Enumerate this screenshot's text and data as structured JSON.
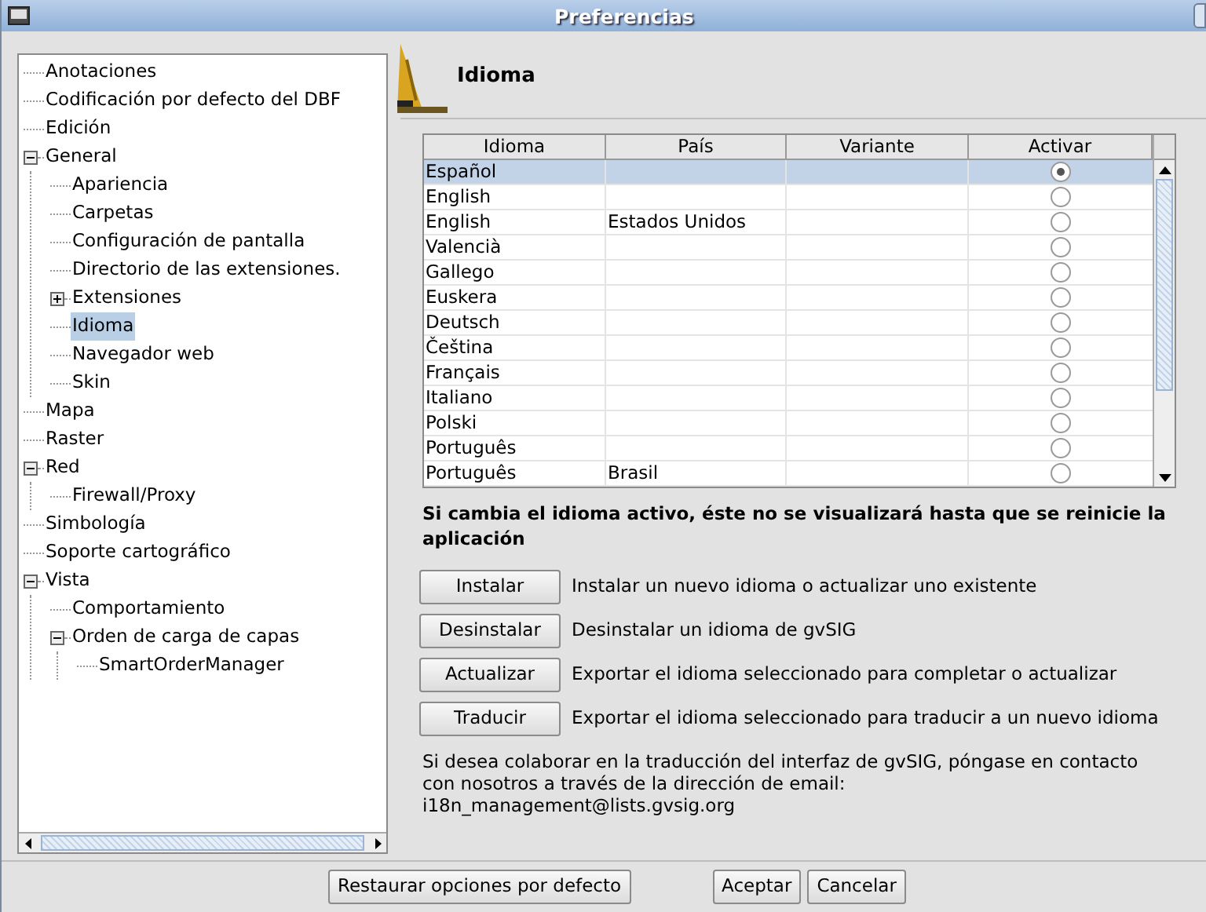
{
  "window": {
    "title": "Preferencias"
  },
  "tree": [
    {
      "label": "Anotaciones",
      "selected": false
    },
    {
      "label": "Codificación por defecto del DBF",
      "selected": false
    },
    {
      "label": "Edición",
      "selected": false
    },
    {
      "label": "General",
      "selected": false,
      "expanded": true,
      "children": [
        {
          "label": "Apariencia",
          "selected": false
        },
        {
          "label": "Carpetas",
          "selected": false
        },
        {
          "label": "Configuración de pantalla",
          "selected": false
        },
        {
          "label": "Directorio de las extensiones.",
          "selected": false
        },
        {
          "label": "Extensiones",
          "selected": false,
          "expanded": false
        },
        {
          "label": "Idioma",
          "selected": true
        },
        {
          "label": "Navegador web",
          "selected": false
        },
        {
          "label": "Skin",
          "selected": false
        }
      ]
    },
    {
      "label": "Mapa",
      "selected": false
    },
    {
      "label": "Raster",
      "selected": false
    },
    {
      "label": "Red",
      "selected": false,
      "expanded": true,
      "children": [
        {
          "label": "Firewall/Proxy",
          "selected": false
        }
      ]
    },
    {
      "label": "Simbología",
      "selected": false
    },
    {
      "label": "Soporte cartográfico",
      "selected": false
    },
    {
      "label": "Vista",
      "selected": false,
      "expanded": true,
      "children": [
        {
          "label": "Comportamiento",
          "selected": false
        },
        {
          "label": "Orden de carga de capas",
          "selected": false,
          "expanded": true,
          "children": [
            {
              "label": "SmartOrderManager",
              "selected": false
            }
          ]
        }
      ]
    }
  ],
  "page_title": "Idioma",
  "table": {
    "columns": [
      "Idioma",
      "País",
      "Variante",
      "Activar"
    ],
    "rows": [
      {
        "idioma": "Español",
        "selected": true,
        "active": true
      },
      {
        "idioma": "English",
        "selected": false,
        "active": false
      },
      {
        "idioma": "English",
        "pais": "Estados Unidos",
        "selected": false,
        "active": false
      },
      {
        "idioma": "Valencià",
        "selected": false,
        "active": false
      },
      {
        "idioma": "Gallego",
        "selected": false,
        "active": false
      },
      {
        "idioma": "Euskera",
        "selected": false,
        "active": false
      },
      {
        "idioma": "Deutsch",
        "selected": false,
        "active": false
      },
      {
        "idioma": "Čeština",
        "selected": false,
        "active": false
      },
      {
        "idioma": "Français",
        "selected": false,
        "active": false
      },
      {
        "idioma": "Italiano",
        "selected": false,
        "active": false
      },
      {
        "idioma": "Polski",
        "selected": false,
        "active": false
      },
      {
        "idioma": "Português",
        "selected": false,
        "active": false
      },
      {
        "idioma": "Português",
        "pais": "Brasil",
        "selected": false,
        "active": false
      }
    ]
  },
  "notice": "Si cambia el idioma activo, éste no se visualizará hasta que se reinicie la aplicación",
  "actions": [
    {
      "button": "Instalar",
      "description": "Instalar un nuevo idioma o actualizar uno existente"
    },
    {
      "button": "Desinstalar",
      "description": "Desinstalar un idioma de gvSIG"
    },
    {
      "button": "Actualizar",
      "description": "Exportar el idioma seleccionado para completar o actualizar"
    },
    {
      "button": "Traducir",
      "description": "Exportar el idioma seleccionado para traducir a un nuevo idioma"
    }
  ],
  "info": "Si desea colaborar en la traducción del interfaz de gvSIG, póngase en contacto con nosotros a través de la dirección de email:",
  "email": "i18n_management@lists.gvsig.org",
  "footer_buttons": [
    {
      "label": "Restaurar opciones por defecto"
    },
    {
      "label": "Aceptar"
    },
    {
      "label": "Cancelar"
    }
  ]
}
